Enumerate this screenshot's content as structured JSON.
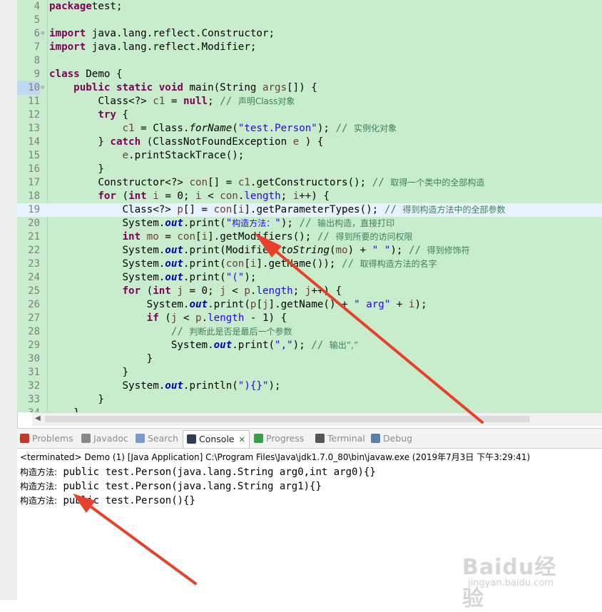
{
  "editor": {
    "lines": [
      {
        "n": "4",
        "parts": [
          [
            "kw",
            "package"
          ],
          [
            "",
            "test;"
          ]
        ]
      },
      {
        "n": "5",
        "parts": []
      },
      {
        "n": "6",
        "fold": "⊖",
        "parts": [
          [
            "kw",
            "import"
          ],
          [
            "",
            " java.lang.reflect.Constructor;"
          ]
        ]
      },
      {
        "n": "7",
        "parts": [
          [
            "kw",
            "import"
          ],
          [
            "",
            " java.lang.reflect.Modifier;"
          ]
        ]
      },
      {
        "n": "8",
        "parts": []
      },
      {
        "n": "9",
        "parts": [
          [
            "kw",
            "class"
          ],
          [
            "",
            " Demo {"
          ]
        ]
      },
      {
        "n": "10",
        "fold": "⊖",
        "hl": true,
        "parts": [
          [
            "",
            "    "
          ],
          [
            "kw",
            "public static void"
          ],
          [
            "",
            " main(String "
          ],
          [
            "var",
            "args"
          ],
          [
            "",
            "[]) {"
          ]
        ]
      },
      {
        "n": "11",
        "parts": [
          [
            "",
            "        Class<?> "
          ],
          [
            "var",
            "c1"
          ],
          [
            "",
            " = "
          ],
          [
            "kw",
            "null"
          ],
          [
            "",
            "; "
          ],
          [
            "cm",
            "// "
          ],
          [
            "cmcn",
            "声明Class对象"
          ]
        ]
      },
      {
        "n": "12",
        "parts": [
          [
            "",
            "        "
          ],
          [
            "kw",
            "try"
          ],
          [
            "",
            " {"
          ]
        ]
      },
      {
        "n": "13",
        "parts": [
          [
            "",
            "            "
          ],
          [
            "var",
            "c1"
          ],
          [
            "",
            " = Class."
          ],
          [
            "it",
            "forName"
          ],
          [
            "",
            "("
          ],
          [
            "str",
            "\"test.Person\""
          ],
          [
            "",
            "); "
          ],
          [
            "cm",
            "// "
          ],
          [
            "cmcn",
            "实例化对象"
          ]
        ]
      },
      {
        "n": "14",
        "parts": [
          [
            "",
            "        } "
          ],
          [
            "kw",
            "catch"
          ],
          [
            "",
            " (ClassNotFoundException "
          ],
          [
            "var",
            "e"
          ],
          [
            "",
            " ) {"
          ]
        ]
      },
      {
        "n": "15",
        "parts": [
          [
            "",
            "            "
          ],
          [
            "var",
            "e"
          ],
          [
            "",
            ".printStackTrace();"
          ]
        ]
      },
      {
        "n": "16",
        "parts": [
          [
            "",
            "        }"
          ]
        ]
      },
      {
        "n": "17",
        "parts": [
          [
            "",
            "        Constructor<?> "
          ],
          [
            "var",
            "con"
          ],
          [
            "",
            "[] = "
          ],
          [
            "var",
            "c1"
          ],
          [
            "",
            ".getConstructors(); "
          ],
          [
            "cm",
            "// "
          ],
          [
            "cmcn",
            "取得一个类中的全部构造"
          ]
        ]
      },
      {
        "n": "18",
        "parts": [
          [
            "",
            "        "
          ],
          [
            "kw",
            "for"
          ],
          [
            "",
            " ("
          ],
          [
            "kw",
            "int"
          ],
          [
            "",
            " "
          ],
          [
            "var",
            "i"
          ],
          [
            "",
            " = 0; "
          ],
          [
            "var",
            "i"
          ],
          [
            "",
            " < "
          ],
          [
            "var",
            "con"
          ],
          [
            "",
            "."
          ],
          [
            "str",
            "length"
          ],
          [
            "",
            "; "
          ],
          [
            "var",
            "i"
          ],
          [
            "",
            "++) {"
          ]
        ]
      },
      {
        "n": "19",
        "current": true,
        "parts": [
          [
            "",
            "            Class<?> "
          ],
          [
            "var",
            "p"
          ],
          [
            "",
            "[] = "
          ],
          [
            "var",
            "con"
          ],
          [
            "",
            "["
          ],
          [
            "var",
            "i"
          ],
          [
            "",
            "].getParameterTypes(); "
          ],
          [
            "cm",
            "// "
          ],
          [
            "cmcn",
            "得到构造方法中的全部参数"
          ]
        ]
      },
      {
        "n": "20",
        "parts": [
          [
            "",
            "            System."
          ],
          [
            "fld",
            "out"
          ],
          [
            "",
            ".print("
          ],
          [
            "str",
            "\""
          ],
          [
            "strcn",
            "构造方法："
          ],
          [
            "str",
            "\""
          ],
          [
            "",
            "); "
          ],
          [
            "cm",
            "// "
          ],
          [
            "cmcn",
            "输出构造，直接打印"
          ]
        ]
      },
      {
        "n": "21",
        "parts": [
          [
            "",
            "            "
          ],
          [
            "kw",
            "int"
          ],
          [
            "",
            " "
          ],
          [
            "var",
            "mo"
          ],
          [
            "",
            " = "
          ],
          [
            "var",
            "con"
          ],
          [
            "",
            "["
          ],
          [
            "var",
            "i"
          ],
          [
            "",
            "].getModifiers(); "
          ],
          [
            "cm",
            "// "
          ],
          [
            "cmcn",
            "得到所要的访问权限"
          ]
        ]
      },
      {
        "n": "22",
        "parts": [
          [
            "",
            "            System."
          ],
          [
            "fld",
            "out"
          ],
          [
            "",
            ".print(Modifier."
          ],
          [
            "it",
            "toString"
          ],
          [
            "",
            "("
          ],
          [
            "var",
            "mo"
          ],
          [
            "",
            ") + "
          ],
          [
            "str",
            "\" \""
          ],
          [
            "",
            "); "
          ],
          [
            "cm",
            "// "
          ],
          [
            "cmcn",
            "得到修饰符"
          ]
        ]
      },
      {
        "n": "23",
        "parts": [
          [
            "",
            "            System."
          ],
          [
            "fld",
            "out"
          ],
          [
            "",
            ".print("
          ],
          [
            "var",
            "con"
          ],
          [
            "",
            "["
          ],
          [
            "var",
            "i"
          ],
          [
            "",
            "].getName()); "
          ],
          [
            "cm",
            "// "
          ],
          [
            "cmcn",
            "取得构造方法的名字"
          ]
        ]
      },
      {
        "n": "24",
        "parts": [
          [
            "",
            "            System."
          ],
          [
            "fld",
            "out"
          ],
          [
            "",
            ".print("
          ],
          [
            "str",
            "\"(\""
          ],
          [
            "",
            "); "
          ]
        ]
      },
      {
        "n": "25",
        "parts": [
          [
            "",
            "            "
          ],
          [
            "kw",
            "for"
          ],
          [
            "",
            " ("
          ],
          [
            "kw",
            "int"
          ],
          [
            "",
            " "
          ],
          [
            "var",
            "j"
          ],
          [
            "",
            " = 0; "
          ],
          [
            "var",
            "j"
          ],
          [
            "",
            " < "
          ],
          [
            "var",
            "p"
          ],
          [
            "",
            "."
          ],
          [
            "str",
            "length"
          ],
          [
            "",
            "; "
          ],
          [
            "var",
            "j"
          ],
          [
            "",
            "++) {"
          ]
        ]
      },
      {
        "n": "26",
        "parts": [
          [
            "",
            "                System."
          ],
          [
            "fld",
            "out"
          ],
          [
            "",
            ".print("
          ],
          [
            "var",
            "p"
          ],
          [
            "",
            "["
          ],
          [
            "var",
            "j"
          ],
          [
            "",
            "].getName() + "
          ],
          [
            "str",
            "\" arg\""
          ],
          [
            "",
            " + "
          ],
          [
            "var",
            "i"
          ],
          [
            "",
            ");"
          ]
        ]
      },
      {
        "n": "27",
        "parts": [
          [
            "",
            "                "
          ],
          [
            "kw",
            "if"
          ],
          [
            "",
            " ("
          ],
          [
            "var",
            "j"
          ],
          [
            "",
            " < "
          ],
          [
            "var",
            "p"
          ],
          [
            "",
            "."
          ],
          [
            "str",
            "length"
          ],
          [
            "",
            " - 1) {"
          ]
        ]
      },
      {
        "n": "28",
        "parts": [
          [
            "",
            "                    "
          ],
          [
            "cm",
            "// "
          ],
          [
            "cmcn",
            "判断此是否是最后一个参数"
          ]
        ]
      },
      {
        "n": "29",
        "parts": [
          [
            "",
            "                    System."
          ],
          [
            "fld",
            "out"
          ],
          [
            "",
            ".print("
          ],
          [
            "str",
            "\",\""
          ],
          [
            "",
            "); "
          ],
          [
            "cm",
            "// "
          ],
          [
            "cmcn",
            "输出“,”"
          ]
        ]
      },
      {
        "n": "30",
        "parts": [
          [
            "",
            "                }"
          ]
        ]
      },
      {
        "n": "31",
        "parts": [
          [
            "",
            "            }"
          ]
        ]
      },
      {
        "n": "32",
        "parts": [
          [
            "",
            "            System."
          ],
          [
            "fld",
            "out"
          ],
          [
            "",
            ".println("
          ],
          [
            "str",
            "\"){}\""
          ],
          [
            "",
            ");"
          ]
        ]
      },
      {
        "n": "33",
        "parts": [
          [
            "",
            "        }"
          ]
        ]
      },
      {
        "n": "34",
        "parts": [
          [
            "",
            "    }"
          ]
        ]
      }
    ]
  },
  "console": {
    "tabs": [
      {
        "label": "Problems",
        "icon": "problems-icon",
        "color": "#c0392b"
      },
      {
        "label": "Javadoc",
        "icon": "javadoc-icon",
        "color": "#888888"
      },
      {
        "label": "Search",
        "icon": "search-icon",
        "color": "#7a9cc6"
      },
      {
        "label": "Console",
        "icon": "console-icon",
        "color": "#2c3e50",
        "active": true,
        "close": "✕"
      },
      {
        "label": "Progress",
        "icon": "progress-icon",
        "color": "#3c9a4a"
      },
      {
        "label": "Terminal",
        "icon": "terminal-icon",
        "color": "#555555"
      },
      {
        "label": "Debug",
        "icon": "debug-icon",
        "color": "#5c7fa8"
      }
    ],
    "status": "<terminated> Demo (1) [Java Application] C:\\Program Files\\Java\\jdk1.7.0_80\\bin\\javaw.exe (2019年7月3日 下午3:29:41)",
    "output": [
      {
        "prefix": "构造方法:",
        "text": " public test.Person(java.lang.String arg0,int arg0){}"
      },
      {
        "prefix": "构造方法:",
        "text": " public test.Person(java.lang.String arg1){}"
      },
      {
        "prefix": "构造方法:",
        "text": " public test.Person(){}"
      }
    ]
  },
  "watermark": {
    "brand": "Baidu经验",
    "url": "jingyan.baidu.com"
  },
  "colors": {
    "editor_bg": "#c7edcc",
    "arrow": "#e8402a"
  }
}
